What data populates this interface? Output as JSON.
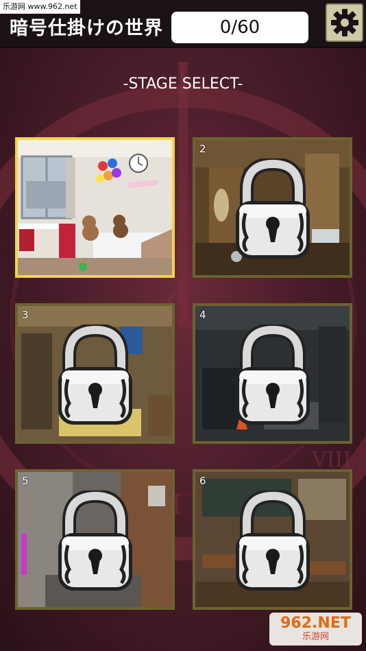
{
  "watermark_top": "乐游网 www.962.net",
  "header": {
    "title": "暗号仕掛けの世界",
    "progress_counter": "0/60"
  },
  "settings_icon": "gear-icon",
  "screen_title": "-STAGE SELECT-",
  "stages": [
    {
      "number": "",
      "locked": false,
      "selected": true,
      "scene": "bedroom"
    },
    {
      "number": "2",
      "locked": true,
      "selected": false,
      "scene": "washroom"
    },
    {
      "number": "3",
      "locked": true,
      "selected": false,
      "scene": "room"
    },
    {
      "number": "4",
      "locked": true,
      "selected": false,
      "scene": "storage"
    },
    {
      "number": "5",
      "locked": true,
      "selected": false,
      "scene": "hospital"
    },
    {
      "number": "6",
      "locked": true,
      "selected": false,
      "scene": "classroom"
    }
  ],
  "watermark_bottom": {
    "main": "962.NET",
    "sub": "乐游网"
  },
  "colors": {
    "selected_border": "#f1d648",
    "stage_border": "#6b6330",
    "header_bg": "#1a1214",
    "background": "#4a1d2a"
  }
}
